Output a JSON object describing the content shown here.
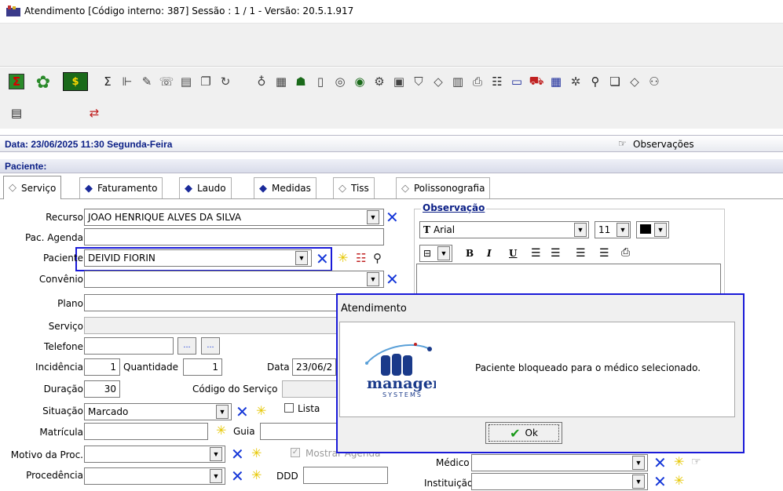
{
  "window": {
    "title": "Atendimento [Código interno: 387]  Sessão : 1 / 1 - Versão: 20.5.1.917"
  },
  "toolbar": {
    "row1_icons": [
      "sigma-box-icon",
      "money-tree-icon",
      "cash-icon",
      "sigma-icon",
      "tree-icon",
      "brush-icon",
      "phone-icon",
      "device-icon",
      "copy-icon",
      "refresh-icon",
      "stamp-icon",
      "grid-icon",
      "people-icon",
      "doc-icon",
      "disc-icon",
      "disc2-icon",
      "gear-icon",
      "book-icon",
      "shield-icon",
      "eraser-icon",
      "columns-icon",
      "printer-icon",
      "person-doc-icon",
      "window-icon",
      "car-icon",
      "calendar-icon",
      "bug-icon",
      "zoom-doc-icon",
      "pages-icon",
      "eraser2-icon",
      "help-icon"
    ],
    "row2_icons": [
      "doc-copy-icon",
      "swap-icon"
    ]
  },
  "date_bar": {
    "text": "Data: 23/06/2025 11:30   Segunda-Feira",
    "observacoes": "Observações"
  },
  "patient_bar": {
    "label": "Paciente:"
  },
  "tabs": [
    {
      "label": "Serviço",
      "active": true
    },
    {
      "label": "Faturamento",
      "active": false
    },
    {
      "label": "Laudo",
      "active": false
    },
    {
      "label": "Medidas",
      "active": false
    },
    {
      "label": "Tiss",
      "active": false
    },
    {
      "label": "Polissonografia",
      "active": false
    }
  ],
  "form": {
    "recurso": {
      "label": "Recurso",
      "value": "JOAO HENRIQUE ALVES DA SILVA"
    },
    "pac_agenda": {
      "label": "Pac. Agenda",
      "value": ""
    },
    "paciente": {
      "label": "Paciente",
      "value": "DEIVID FIORIN"
    },
    "convenio": {
      "label": "Convênio",
      "value": ""
    },
    "plano": {
      "label": "Plano",
      "value": ""
    },
    "servico": {
      "label": "Serviço",
      "value": ""
    },
    "telefone": {
      "label": "Telefone",
      "value": "",
      "dots": "..."
    },
    "incidencia": {
      "label": "Incidência",
      "value": "1"
    },
    "quantidade": {
      "label": "Quantidade",
      "value": "1"
    },
    "data": {
      "label": "Data",
      "value": "23/06/2"
    },
    "duracao": {
      "label": "Duração",
      "value": "30"
    },
    "codigo_servico": {
      "label": "Código do Serviço",
      "value": ""
    },
    "situacao": {
      "label": "Situação",
      "value": "Marcado"
    },
    "lista": {
      "label": "Lista"
    },
    "matricula": {
      "label": "Matrícula",
      "value": ""
    },
    "guia": {
      "label": "Guia",
      "value": ""
    },
    "motivo_proc": {
      "label": "Motivo da Proc.",
      "value": ""
    },
    "mostrar_agenda": {
      "label": "Mostrar Agenda"
    },
    "procedencia": {
      "label": "Procedência",
      "value": ""
    },
    "ddd": {
      "label": "DDD",
      "value": ""
    },
    "medico": {
      "label": "Médico",
      "value": ""
    },
    "instituicao": {
      "label": "Instituição",
      "value": ""
    }
  },
  "observacao": {
    "title": "Observação",
    "font": "Arial",
    "font_size": "11",
    "bold": "B",
    "italic": "I",
    "underline": "U"
  },
  "dialog": {
    "title": "Atendimento",
    "message": "Paciente bloqueado para o médico selecionado.",
    "ok": "Ok",
    "logo_word": "manager",
    "logo_sub": "SYSTEMS"
  },
  "colors": {
    "accent": "#1a1ad8",
    "header_text": "#0b1f86",
    "x_blue": "#1335d8",
    "sun_yellow": "#e6c700"
  }
}
